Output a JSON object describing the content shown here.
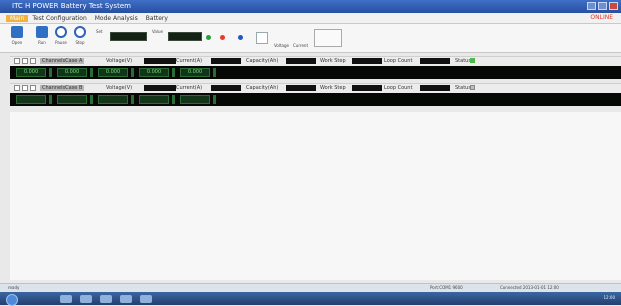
{
  "window": {
    "title": "ITC H POWER Battery Test System"
  },
  "menu": {
    "items": [
      "Test Configuration",
      "Mode Analysis",
      "Battery"
    ],
    "active": "Main",
    "right_text": "ONLINE"
  },
  "toolbar": {
    "buttons": [
      {
        "label": "Open"
      },
      {
        "label": "Run"
      },
      {
        "label": "Pause"
      },
      {
        "label": "Stop"
      }
    ],
    "field1_label": "Set",
    "field2_label": "Value",
    "status_dots": {
      "green": "#23a33b",
      "red": "#e53b2d",
      "blue": "#2257c5"
    },
    "extra_labels": [
      "Voltage",
      "Current"
    ]
  },
  "rows": [
    {
      "headers": [
        "ChannelsCase A",
        "Voltage(V)",
        "Current(A)",
        "Capacity(Ah)",
        "Work Step",
        "Loop Count",
        "Status"
      ],
      "cells": [
        "0.000",
        "0.000",
        "0.000",
        "0.000",
        "0.000"
      ],
      "status_color": "#4cb84c"
    },
    {
      "headers": [
        "ChannelsCase B",
        "Voltage(V)",
        "Current(A)",
        "Capacity(Ah)",
        "Work Step",
        "Loop Count",
        "Status"
      ],
      "cells": [
        "",
        "",
        "",
        "",
        ""
      ],
      "status_color": "#bdbdbd"
    }
  ],
  "status_bar": {
    "left": "ready",
    "mid": "Port:COM1 9600",
    "right": "Connected 2013-01-01 12:00"
  },
  "taskbar": {
    "tray_text": "12:00"
  }
}
